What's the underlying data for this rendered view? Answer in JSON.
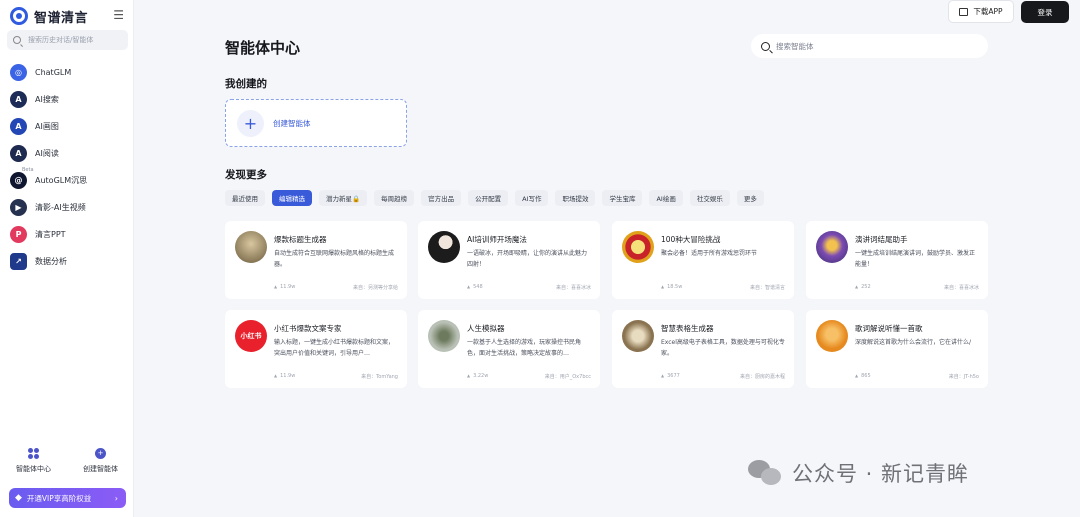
{
  "app": {
    "name": "智谱清言",
    "search_placeholder": "搜索历史对话/智能体"
  },
  "sidebar": {
    "items": [
      {
        "label": "ChatGLM",
        "icon": "chatglm-logo-icon",
        "color": "#3b63e6"
      },
      {
        "label": "AI搜索",
        "icon": "ai-search-icon",
        "color": "#1d2b57"
      },
      {
        "label": "AI画图",
        "icon": "ai-draw-icon",
        "color": "#2348b5"
      },
      {
        "label": "AI阅读",
        "icon": "ai-read-icon",
        "color": "#1e2a4f"
      },
      {
        "label": "AutoGLM沉思",
        "icon": "autoglm-icon",
        "color": "#0f1630",
        "badge": "Beta"
      },
      {
        "label": "清影-AI生视频",
        "icon": "video-icon",
        "color": "#26304f"
      },
      {
        "label": "清言PPT",
        "icon": "ppt-icon",
        "color": "#e2395e"
      },
      {
        "label": "数据分析",
        "icon": "data-analysis-icon",
        "color": "#1f3a8a"
      }
    ],
    "bottom": [
      {
        "label": "智能体中心",
        "icon": "grid-icon"
      },
      {
        "label": "创建智能体",
        "icon": "create-agent-icon"
      }
    ],
    "vip_label": "开通VIP享高阶权益"
  },
  "header": {
    "download_label": "下载APP",
    "login_label": "登录"
  },
  "main": {
    "title": "智能体中心",
    "search_placeholder": "搜索智能体",
    "my_created": "我创建的",
    "create_label": "创建智能体",
    "discover": "发现更多",
    "tabs": [
      "最近使用",
      "编辑精选",
      "潜力新星🔒",
      "每周趋榜",
      "官方出品",
      "公开配置",
      "AI写作",
      "职场提效",
      "学生宝库",
      "AI绘画",
      "社交娱乐",
      "更多"
    ],
    "active_tab": 1
  },
  "cards": [
    {
      "title": "爆款标题生成器",
      "desc": "自动生成符合互联网爆款标题风格的标题生成器。",
      "count": "11.9w",
      "author": "来自：另测等分享给",
      "avatar_color": "#8a7a5a",
      "avatar_text": ""
    },
    {
      "title": "AI培训师开场魔法",
      "desc": "一语破冰，开场即吸睛，让你的演讲从此魅力四射！",
      "count": "548",
      "author": "来自：喜喜冰冰",
      "avatar_color": "#2a2a2a",
      "avatar_text": ""
    },
    {
      "title": "100种大冒险挑战",
      "desc": "聚会必备！适用于所有游戏惩罚环节",
      "count": "18.5w",
      "author": "来自：智谱清言",
      "avatar_color": "#e0a21a",
      "avatar_text": ""
    },
    {
      "title": "演讲词结尾助手",
      "desc": "一键生成培训结尾演讲词，鼓励学员、激发正能量！",
      "count": "252",
      "author": "来自：喜喜冰冰",
      "avatar_color": "#b56bd1",
      "avatar_text": ""
    },
    {
      "title": "小红书爆款文案专家",
      "desc": "输入标题，一键生成小红书爆款标题和文案，突出用户价值和关键词，引导用户…",
      "count": "11.9w",
      "author": "来自：TomYang",
      "avatar_color": "#e8212c",
      "avatar_text": "小红书"
    },
    {
      "title": "人生模拟器",
      "desc": "一款基于人生选择的游戏，玩家操控书民角色，面对生活挑战，策略决定故事的…",
      "count": "3.22w",
      "author": "来自：用户_Ox7bcc",
      "avatar_color": "#9aa39a",
      "avatar_text": ""
    },
    {
      "title": "智慧表格生成器",
      "desc": "Excel高级电子表格工具，数据处理与可视化专家。",
      "count": "3677",
      "author": "来自：厨房的嘉木程",
      "avatar_color": "#8a7350",
      "avatar_text": ""
    },
    {
      "title": "歌词解说听懂一首歌",
      "desc": "深度解说这首歌为什么会流行，它在讲什么/",
      "count": "865",
      "author": "来自：JT-h5o",
      "avatar_color": "#e68a1f",
      "avatar_text": ""
    }
  ],
  "watermark": "公众号 · 新记青眸"
}
